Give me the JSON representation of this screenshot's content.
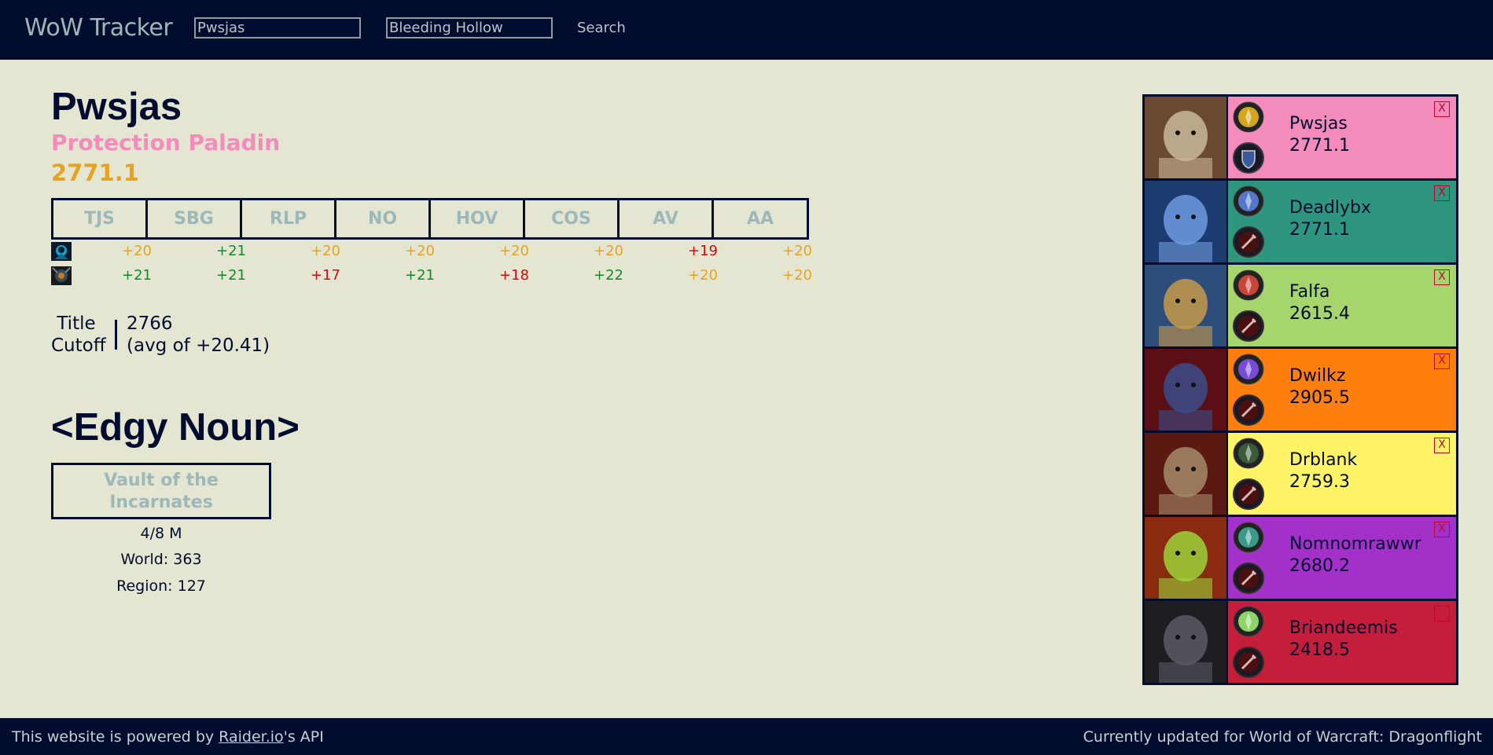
{
  "header": {
    "brand": "WoW Tracker",
    "character_field": "Pwsjas",
    "realm_field": "Bleeding Hollow",
    "search_label": "Search"
  },
  "character": {
    "name": "Pwsjas",
    "spec": "Protection Paladin",
    "score": "2771.1"
  },
  "dungeons": [
    "TJS",
    "SBG",
    "RLP",
    "NO",
    "HOV",
    "COS",
    "AV",
    "AA"
  ],
  "runs": [
    {
      "icon": "shadow-affix-icon",
      "values": [
        {
          "text": "+20",
          "color": "#e6a321"
        },
        {
          "text": "+21",
          "color": "#0f8a2c"
        },
        {
          "text": "+20",
          "color": "#e6a321"
        },
        {
          "text": "+20",
          "color": "#e6a321"
        },
        {
          "text": "+20",
          "color": "#e6a321"
        },
        {
          "text": "+20",
          "color": "#e6a321"
        },
        {
          "text": "+19",
          "color": "#d10a0a"
        },
        {
          "text": "+20",
          "color": "#e6a321"
        }
      ]
    },
    {
      "icon": "storm-affix-icon",
      "values": [
        {
          "text": "+21",
          "color": "#0f8a2c"
        },
        {
          "text": "+21",
          "color": "#0f8a2c"
        },
        {
          "text": "+17",
          "color": "#d10a0a"
        },
        {
          "text": "+21",
          "color": "#0f8a2c"
        },
        {
          "text": "+18",
          "color": "#d10a0a"
        },
        {
          "text": "+22",
          "color": "#0f8a2c"
        },
        {
          "text": "+20",
          "color": "#e6a321"
        },
        {
          "text": "+20",
          "color": "#e6a321"
        }
      ]
    }
  ],
  "title_cutoff": {
    "label_line1": "Title",
    "label_line2": "Cutoff",
    "value_line1": "2766",
    "value_line2": "(avg of +20.41)"
  },
  "guild": {
    "name": "<Edgy Noun>",
    "raid": "Vault of the Incarnates",
    "progress": "4/8 M",
    "world": "World: 363",
    "region": "Region: 127"
  },
  "tracked": [
    {
      "name": "Pwsjas",
      "score": "2771.1",
      "color": "#f48cbb",
      "spec_icon": "paladin-protection-icon",
      "role_icon": "tank-role-icon",
      "close": "X"
    },
    {
      "name": "Deadlybx",
      "score": "2771.1",
      "color": "#2e957e",
      "spec_icon": "shaman-elemental-icon",
      "role_icon": "dps-role-icon",
      "close": "X"
    },
    {
      "name": "Falfa",
      "score": "2615.4",
      "color": "#a6d56e",
      "spec_icon": "druid-feral-icon",
      "role_icon": "dps-role-icon",
      "close": "X"
    },
    {
      "name": "Dwilkz",
      "score": "2905.5",
      "color": "#ff7f0e",
      "spec_icon": "mage-arcane-icon",
      "role_icon": "dps-role-icon",
      "close": "X"
    },
    {
      "name": "Drblank",
      "score": "2759.3",
      "color": "#fff468",
      "spec_icon": "rogue-outlaw-icon",
      "role_icon": "dps-role-icon",
      "close": "X"
    },
    {
      "name": "Nomnomrawwr",
      "score": "2680.2",
      "color": "#a330c9",
      "spec_icon": "demon-hunter-havoc-icon",
      "role_icon": "dps-role-icon",
      "close": "X"
    },
    {
      "name": "Briandeemis",
      "score": "2418.5",
      "color": "#c41e3a",
      "spec_icon": "death-knight-unholy-icon",
      "role_icon": "dps-role-icon",
      "close": ""
    }
  ],
  "footer": {
    "prefix": "This website is powered by ",
    "link": "Raider.io",
    "suffix": "'s API",
    "right": "Currently updated for World of Warcraft: Dragonflight"
  }
}
